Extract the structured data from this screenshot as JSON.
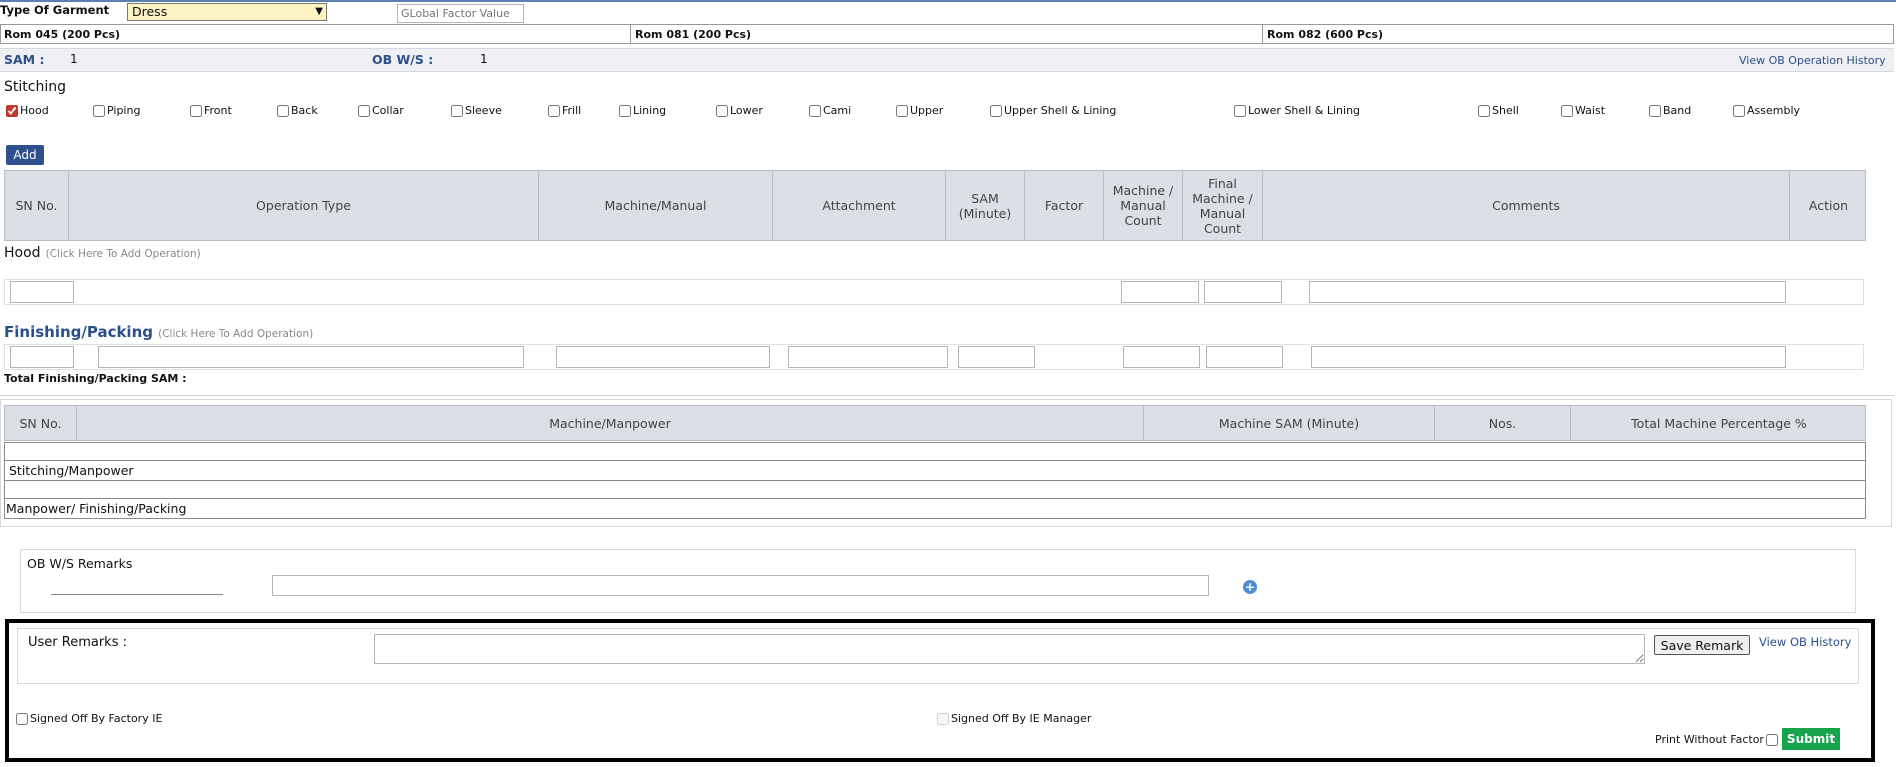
{
  "header": {
    "garment_label": "Type Of Garment",
    "garment_value": "Dress",
    "global_factor_placeholder": "GLobal Factor Value",
    "rom_cells": [
      "Rom 045 (200 Pcs)",
      "Rom 081 (200 Pcs)",
      "Rom 082 (600 Pcs)"
    ]
  },
  "summary": {
    "sam_label": "SAM :",
    "sam_value": "1",
    "obws_label": "OB W/S :",
    "obws_value": "1",
    "history_link": "View OB Operation History"
  },
  "stitching": {
    "title": "Stitching",
    "checkboxes": [
      {
        "label": "Hood",
        "checked": true
      },
      {
        "label": "Piping",
        "checked": false
      },
      {
        "label": "Front",
        "checked": false
      },
      {
        "label": "Back",
        "checked": false
      },
      {
        "label": "Collar",
        "checked": false
      },
      {
        "label": "Sleeve",
        "checked": false
      },
      {
        "label": "Frill",
        "checked": false
      },
      {
        "label": "Lining",
        "checked": false
      },
      {
        "label": "Lower",
        "checked": false
      },
      {
        "label": "Cami",
        "checked": false
      },
      {
        "label": "Upper",
        "checked": false
      },
      {
        "label": "Upper Shell & Lining",
        "checked": false
      },
      {
        "label": "Lower Shell & Lining",
        "checked": false
      },
      {
        "label": "Shell",
        "checked": false
      },
      {
        "label": "Waist",
        "checked": false
      },
      {
        "label": "Band",
        "checked": false
      },
      {
        "label": "Assembly",
        "checked": false
      }
    ],
    "add_button": "Add"
  },
  "ops_table": {
    "columns": [
      "SN No.",
      "Operation Type",
      "Machine/Manual",
      "Attachment",
      "SAM (Minute)",
      "Factor",
      "Machine / Manual Count",
      "Final Machine / Manual Count",
      "Comments",
      "Action"
    ]
  },
  "hood_section": {
    "title": "Hood",
    "hint": "(Click Here To Add Operation)"
  },
  "finishing_section": {
    "title": "Finishing/Packing",
    "hint": "(Click Here To Add Operation)",
    "total_label": "Total Finishing/Packing SAM :"
  },
  "machine_table": {
    "columns": [
      "SN No.",
      "Machine/Manpower",
      "Machine SAM (Minute)",
      "Nos.",
      "Total Machine Percentage %"
    ],
    "rows": [
      "",
      "Stitching/Manpower",
      "",
      "Manpower/ Finishing/Packing"
    ]
  },
  "remarks": {
    "obws_remarks_label": "OB W/S Remarks",
    "user_remarks_label": "User Remarks :",
    "save_remark_button": "Save Remark",
    "view_history_link": "View OB History",
    "signed_factory": "Signed Off By Factory IE",
    "signed_manager": "Signed Off By IE Manager",
    "print_without_factor": "Print Without Factor",
    "submit_button": "Submit"
  },
  "colors": {
    "accent_blue": "#2a4f8a",
    "submit_green": "#18a44c",
    "header_bg": "#dcdfe5",
    "garment_select_bg": "#fbf3c4"
  }
}
